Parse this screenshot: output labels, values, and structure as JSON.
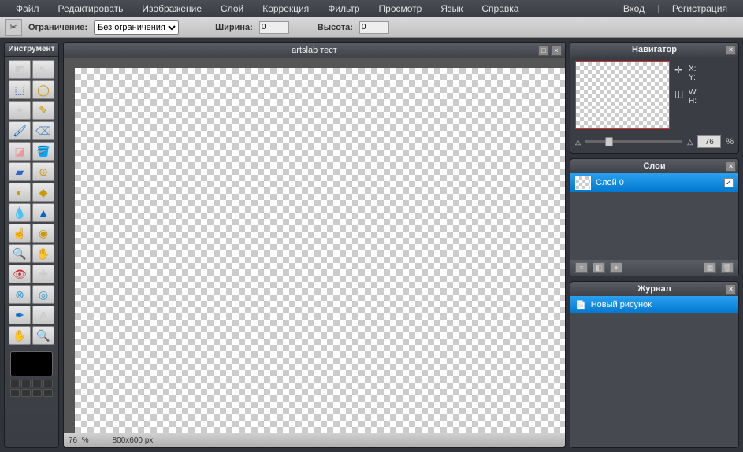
{
  "menubar": {
    "items": [
      "Файл",
      "Редактировать",
      "Изображение",
      "Слой",
      "Коррекция",
      "Фильтр",
      "Просмотр",
      "Язык",
      "Справка"
    ],
    "login": "Вход",
    "register": "Регистрация"
  },
  "optbar": {
    "constraint_label": "Ограничение:",
    "constraint_value": "Без ограничения",
    "width_label": "Ширина:",
    "width_value": "0",
    "height_label": "Высота:",
    "height_value": "0"
  },
  "toolbox": {
    "title": "Инструмент"
  },
  "canvas": {
    "title": "artslab тест",
    "zoom": "76",
    "zoom_pct": "%",
    "dims": "800x600 px"
  },
  "navigator": {
    "title": "Навигатор",
    "x": "X:",
    "y": "Y:",
    "w": "W:",
    "h": "H:",
    "zoom": "76",
    "pct": "%"
  },
  "layers": {
    "title": "Слои",
    "items": [
      {
        "name": "Слой 0",
        "visible": true
      }
    ]
  },
  "journal": {
    "title": "Журнал",
    "items": [
      {
        "name": "Новый рисунок"
      }
    ]
  }
}
